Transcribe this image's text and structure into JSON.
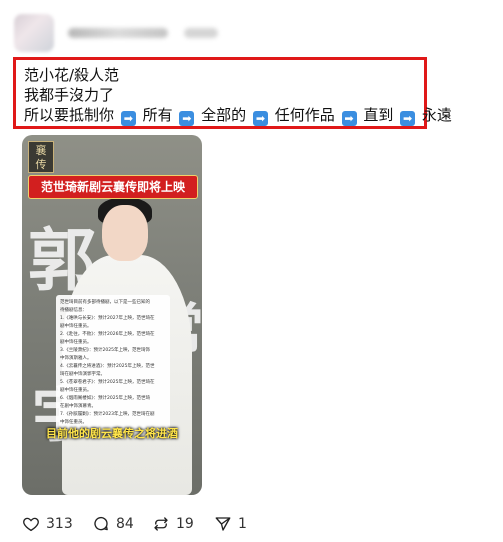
{
  "post": {
    "text_lines": [
      "范小花/殺人范",
      "我都手沒力了"
    ],
    "line3_parts": [
      "所以要抵制你",
      "所有",
      "全部的",
      "任何作品",
      "直到",
      "永遠"
    ],
    "arrow_glyph": "➡"
  },
  "media": {
    "logo_text": "襄\n传",
    "banner": "范世琦新剧云襄传即将上映",
    "big_chars": [
      "郭",
      "宇",
      "常"
    ],
    "list": [
      "范世琦目前有多部待播剧，以下是一些已知的",
      "待播剧信息：",
      "1.《难哄与长安》：预计2027年上映，范世琦在",
      "剧中饰任重员。",
      "2.《赴往，不败》：预计2026年上映，范世琦在",
      "剧中饰任重员。",
      "3.《兰陵萧纪》：预计2025年上映，范世琦饰",
      "中饰演斯雅人。",
      "4.《云襄传之将进酒》：预计2025年上映，范世",
      "琦在剧中饰演郭宇常。",
      "5.《苍翠卷君子》：预计2025年上映，范世琦在",
      "剧中饰任重员。",
      "6.《烟雨阁楼如》：预计2025年上映，范世琦",
      "在剧中饰演慕青。",
      "7.《孙膑履剿》：预计2023年上映，范世琦在剧",
      "中饰任重员。"
    ],
    "caption": "目前他的剧云襄传之将进酒"
  },
  "actions": {
    "likes": "313",
    "replies": "84",
    "reposts": "19",
    "shares": "1"
  },
  "colors": {
    "highlight_border": "#e01818",
    "arrow_bg": "#3b8ee0",
    "banner_bg": "#d21f1f"
  }
}
